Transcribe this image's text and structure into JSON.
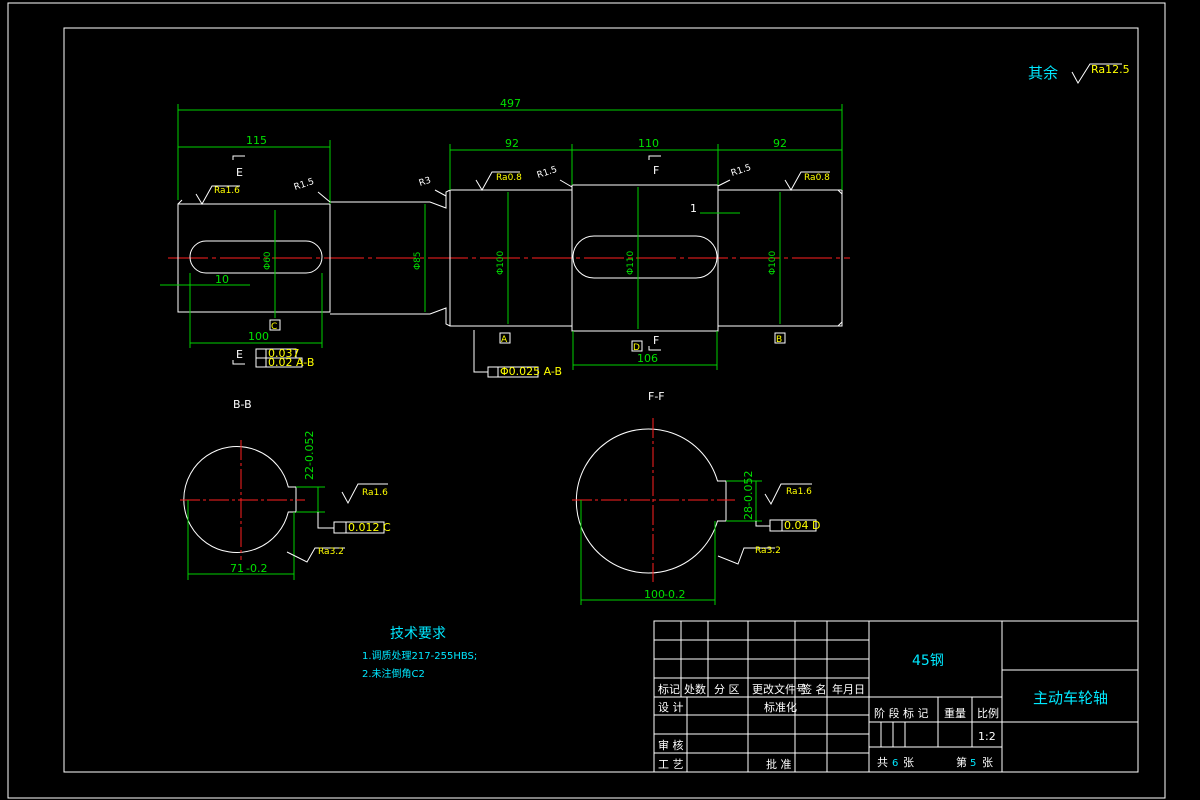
{
  "surface_note": {
    "label": "其余",
    "ra": "Ra12.5"
  },
  "dimensions": {
    "overall": "497",
    "seg1": "115",
    "seg3": "92",
    "seg4": "110",
    "seg5": "92",
    "keyway1_len": "100",
    "keyway1_offset": "10",
    "keyway2_len": "106",
    "step": "1",
    "dia_shoulder": "Φ85",
    "dia_end": "Φ60",
    "dia_bearing_left": "Φ100",
    "dia_mid": "Φ110",
    "dia_bearing_right": "Φ100",
    "bb_width": "71",
    "bb_width_tol": "-0.2",
    "bb_key": "22-0.052",
    "ff_width": "100",
    "ff_width_tol": "-0.2",
    "ff_key": "28-0.052"
  },
  "roughness": {
    "end_left": "Ra1.6",
    "bearing_left": "Ra0.8",
    "bearing_right": "Ra0.8",
    "bb_key": "Ra1.6",
    "bb_outer": "Ra3.2",
    "ff_key": "Ra1.6",
    "ff_outer": "Ra3.2"
  },
  "fillets": {
    "f1": "R1.5",
    "f2": "R3",
    "f3": "R1.5",
    "f4": "R1.5"
  },
  "section_marks": {
    "left": "E",
    "mid": "F"
  },
  "datums": {
    "c": "C",
    "a": "A",
    "d": "D",
    "b": "B"
  },
  "tolerances": {
    "left_1": "0.037",
    "left_2": "0.02  A-B",
    "mid": "Φ0.025  A-B",
    "bb": "0.012  C",
    "ff": "0.04  D"
  },
  "section_labels": {
    "bb": "B-B",
    "ff": "F-F"
  },
  "tech_req": {
    "title": "技术要求",
    "lines": [
      "1.调质处理217-255HBS;",
      "2.未注倒角C2"
    ]
  },
  "title_block": {
    "material": "45钢",
    "part_name": "主动车轮轴",
    "row_headers": [
      "标记",
      "处数",
      "分 区",
      "更改文件号",
      "签 名",
      "年月日"
    ],
    "design": "设 计",
    "standard": "标准化",
    "review": "审 核",
    "process": "工 艺",
    "approve": "批 准",
    "stage": "阶 段 标 记",
    "weight": "重量",
    "scale_label": "比例",
    "scale": "1:2",
    "total_label": "共",
    "total": "6",
    "sheet_unit": "张",
    "page_label": "第",
    "page": "5",
    "page_unit": "张"
  }
}
